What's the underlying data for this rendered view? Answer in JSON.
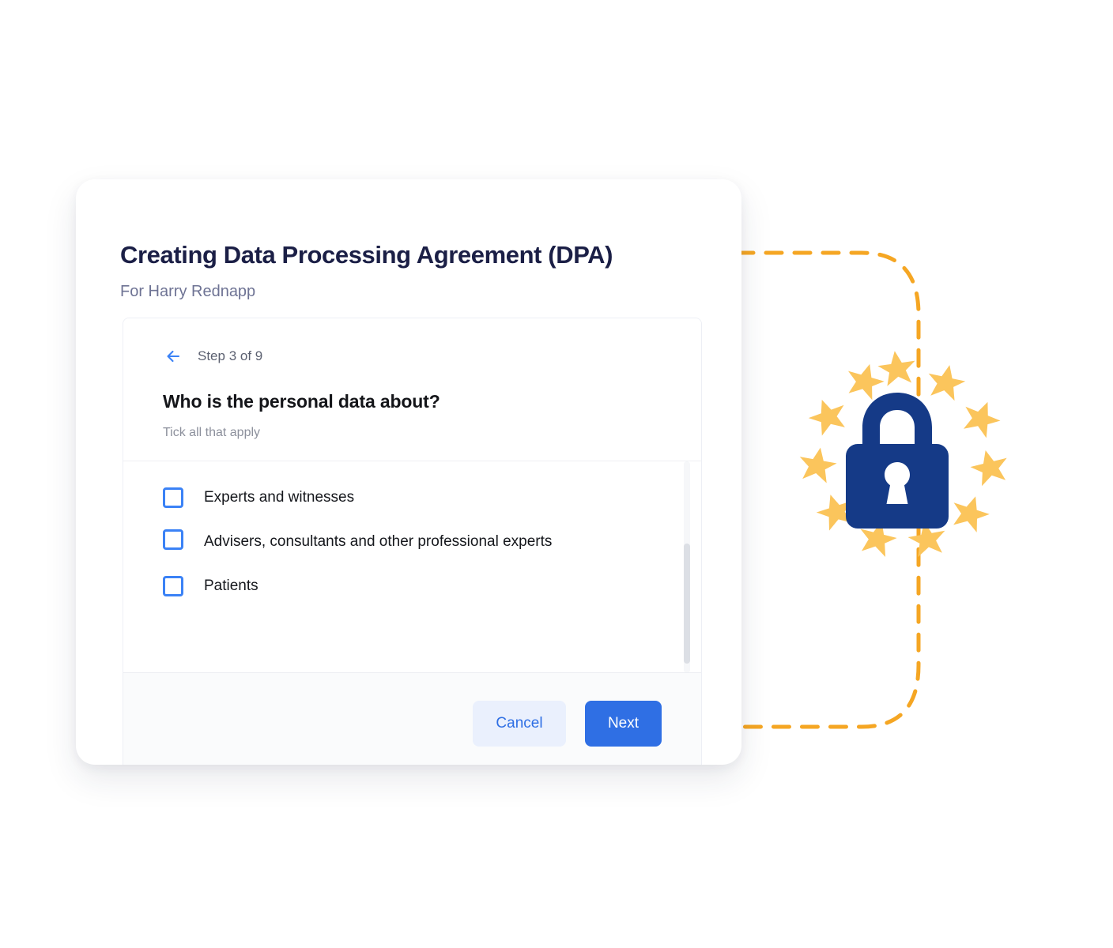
{
  "page": {
    "background_color": "#ffffff"
  },
  "card": {
    "title": "Creating Data Processing Agreement (DPA)",
    "subtitle": "For Harry Rednapp"
  },
  "wizard": {
    "back_arrow_icon": "arrow-left-icon",
    "step_label": "Step 3 of 9",
    "question": "Who is the personal data about?",
    "hint": "Tick all that apply",
    "options": [
      {
        "label": "Experts and witnesses",
        "checked": false,
        "multiline": false
      },
      {
        "label": "Advisers, consultants and other professional experts",
        "checked": false,
        "multiline": true
      },
      {
        "label": "Patients",
        "checked": false,
        "multiline": false
      }
    ],
    "scrollbar": {
      "visible": true
    }
  },
  "footer": {
    "cancel_label": "Cancel",
    "next_label": "Next"
  },
  "emblem": {
    "icon": "padlock-icon",
    "lock_color": "#153a87",
    "star_color": "#fbc55c",
    "star_count": 11
  },
  "connector": {
    "icon": "dashed-path",
    "color": "#f5a623",
    "style": "dashed"
  },
  "colors": {
    "accent_blue": "#2f6fe4",
    "checkbox_blue": "#3b82f6",
    "title_navy": "#1b1f46",
    "subtitle_gray": "#6e7394",
    "orange": "#f5a623",
    "lock_navy": "#153a87",
    "star_yellow": "#fbc55c"
  }
}
